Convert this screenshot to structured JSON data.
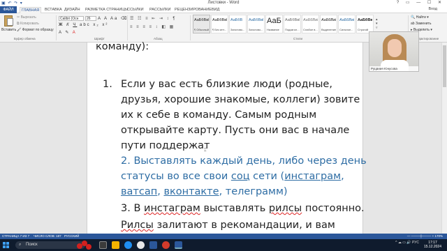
{
  "window": {
    "title": "Листовки - Word",
    "controls": "?  ▭  —  ☐  ✕",
    "user": "Вход"
  },
  "tabs": [
    "ФАЙЛ",
    "ГЛАВНАЯ",
    "ВСТАВКА",
    "ДИЗАЙН",
    "РАЗМЕТКА СТРАНИЦЫ",
    "ССЫЛКИ",
    "РАССЫЛКИ",
    "РЕЦЕНЗИРОВАНИЕ",
    "ВИД"
  ],
  "ribbon": {
    "clipboard": {
      "paste": "Вставить",
      "cut": "Вырезать",
      "copy": "Копировать",
      "format_painter": "Формат по образцу",
      "group": "Буфер обмена"
    },
    "font": {
      "name": "Calibri (Осн",
      "size": "26",
      "group": "Шрифт"
    },
    "paragraph": {
      "group": "Абзац"
    },
    "styles": {
      "group": "Стили",
      "items": [
        {
          "sample": "АаБбВвГг",
          "name": "¶ Обычный"
        },
        {
          "sample": "АаБбВвГг",
          "name": "¶ Без инт..."
        },
        {
          "sample": "АаБбВ",
          "name": "Заголово..."
        },
        {
          "sample": "АаБбВвГ",
          "name": "Заголово..."
        },
        {
          "sample": "АаБ",
          "name": "Название"
        },
        {
          "sample": "АаБбВвГ",
          "name": "Подзагол..."
        },
        {
          "sample": "АаБбВвГг",
          "name": "Слабое в..."
        },
        {
          "sample": "АаБбВвГг",
          "name": "Выделение"
        },
        {
          "sample": "АаБбВвГг",
          "name": "Сильное..."
        },
        {
          "sample": "АаБбВвГг",
          "name": "Строгий"
        }
      ]
    },
    "editing": {
      "find": "Найти",
      "replace": "Заменить",
      "select": "Выделить",
      "group": "Редактирование"
    }
  },
  "document": {
    "line0": "команду):",
    "item1_number": "1.",
    "item1_lines": [
      "Если у вас есть близкие люди (родные,",
      "друзья, хорошие знакомые, коллеги) зовите",
      "их к себе в команду. Самым родным",
      "открывайте карту. Пусть они вас в начале",
      "пути поддержат"
    ],
    "item2_line1": "2. Выставлять каждый день, либо через день",
    "item2_l2_a": "статусы во все свои ",
    "item2_l2_b": "соц",
    "item2_l2_c": " сети (",
    "item2_l2_d": "инстаграм",
    "item2_l2_e": ",",
    "item2_l3_a": "ватсап",
    "item2_l3_b": ", ",
    "item2_l3_c": "вконтакте",
    "item2_l3_d": ", телеграмм)",
    "item3_l1_a": "3. В ",
    "item3_l1_b": "инстаграм",
    "item3_l1_c": " выставлять ",
    "item3_l1_d": "рилсы",
    "item3_l1_e": " постоянно.",
    "item3_l2_a": "Рилсы",
    "item3_l2_b": " залитают в рекомандации, и вам"
  },
  "webcam": {
    "caption": "Руцания Юнусова"
  },
  "statusbar": {
    "page": "СТРАНИЦА 7 ИЗ 7",
    "words": "ЧИСЛО СЛОВ: 187",
    "lang": "РУССКИЙ",
    "zoom": "— ────┼──── + 170%"
  },
  "taskbar": {
    "search": "Поиск",
    "tray": "^ ☁ ▭ 🔊 РУС",
    "time": "17:17",
    "date": "15.12.2024"
  },
  "colors": {
    "word_blue": "#2b579a",
    "doc_blue_text": "#2e6da4",
    "spell_red": "#d22"
  }
}
